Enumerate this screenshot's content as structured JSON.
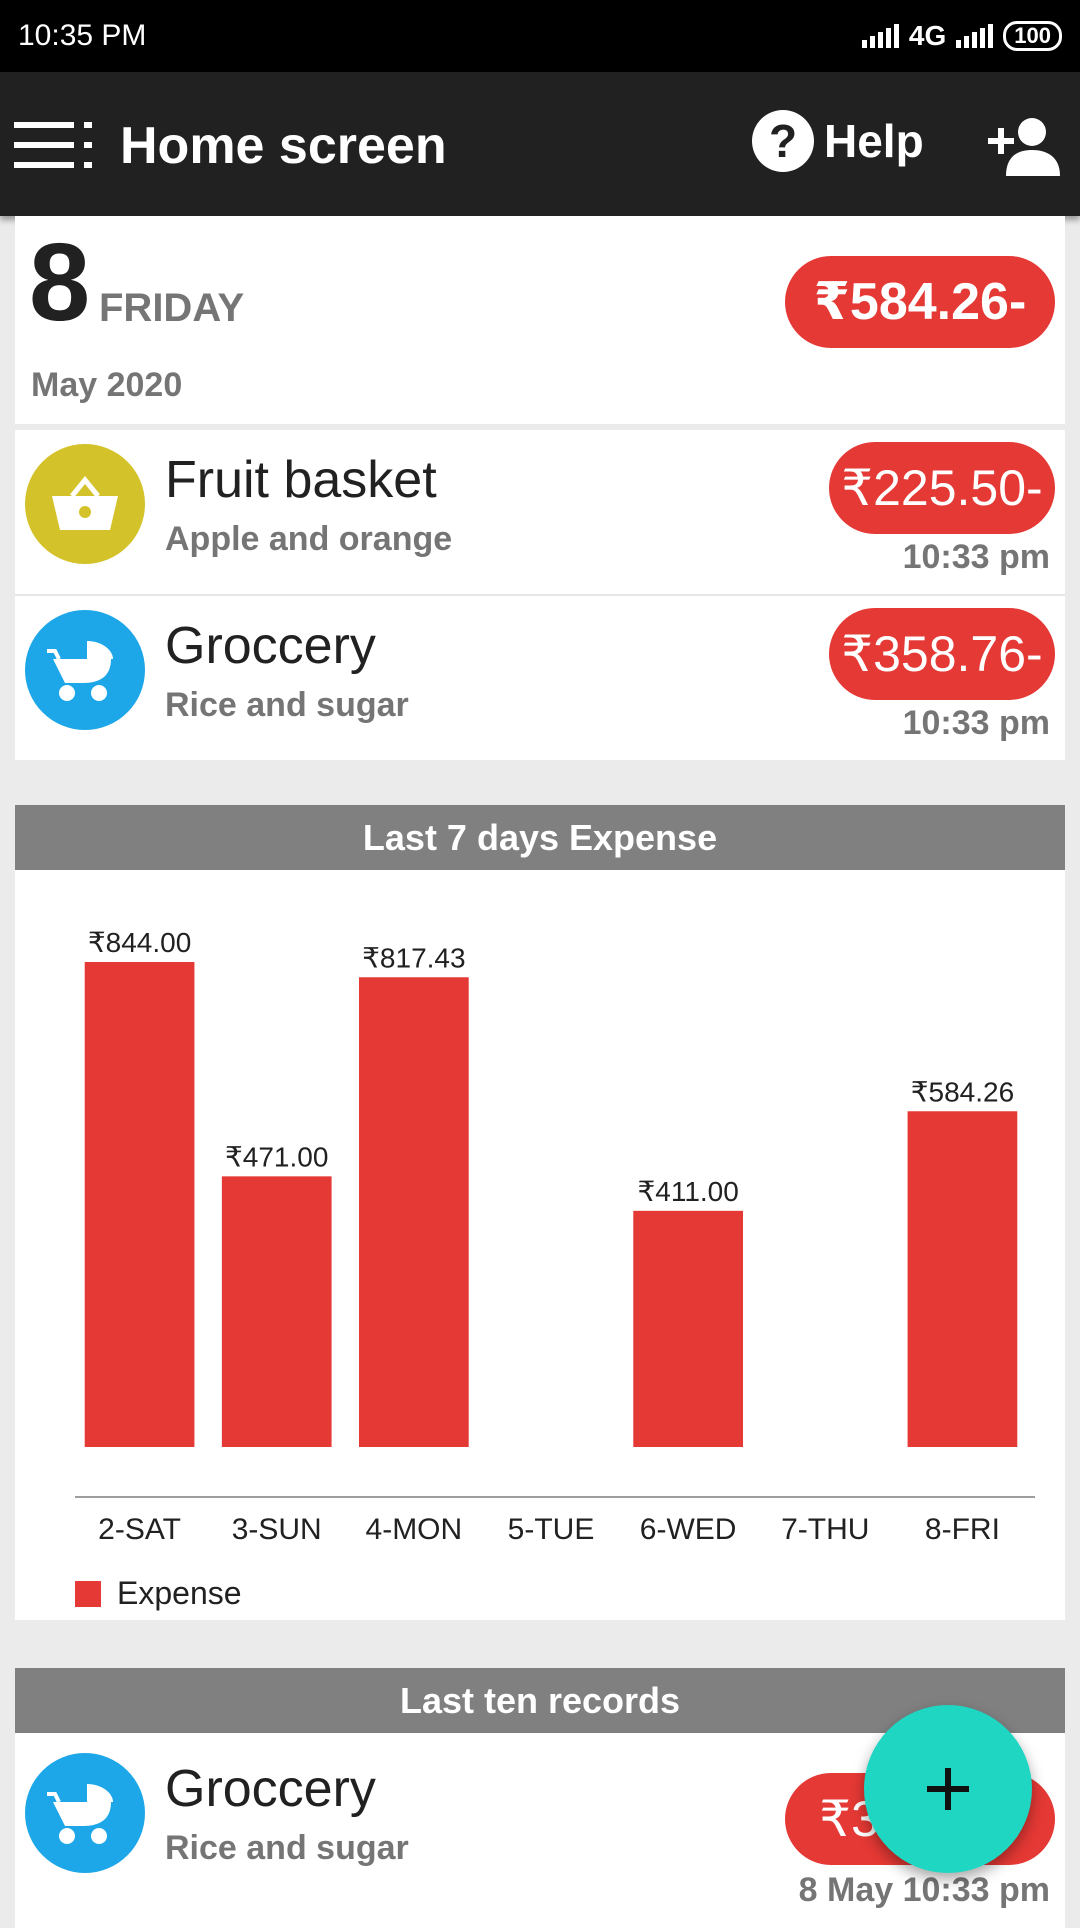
{
  "status_bar": {
    "time": "10:35 PM",
    "network": "4G",
    "battery": "100"
  },
  "app_bar": {
    "title": "Home screen",
    "help_label": "Help"
  },
  "day_summary": {
    "day_number": "8",
    "day_name": "FRIDAY",
    "month_year": "May 2020",
    "total": "₹584.26-"
  },
  "transactions": [
    {
      "title": "Fruit basket",
      "subtitle": "Apple and orange",
      "amount": "₹225.50-",
      "time": "10:33 pm",
      "icon": "basket-icon",
      "icon_color": "#d4c22a"
    },
    {
      "title": "Groccery",
      "subtitle": "Rice and sugar",
      "amount": "₹358.76-",
      "time": "10:33 pm",
      "icon": "stroller-cart-icon",
      "icon_color": "#1ea7e8"
    }
  ],
  "chart_section": {
    "header": "Last 7 days Expense",
    "legend_label": "Expense"
  },
  "chart_data": {
    "type": "bar",
    "categories": [
      "2-SAT",
      "3-SUN",
      "4-MON",
      "5-TUE",
      "6-WED",
      "7-THU",
      "8-FRI"
    ],
    "series": [
      {
        "name": "Expense",
        "values": [
          844.0,
          471.0,
          817.43,
          0,
          411.0,
          0,
          584.26
        ],
        "color": "#e53935"
      }
    ],
    "data_labels": [
      "₹844.00",
      "₹471.00",
      "₹817.43",
      "",
      "₹411.00",
      "",
      "₹584.26"
    ],
    "ylim": [
      0,
      844
    ],
    "legend": "bottom-left",
    "grid": false
  },
  "records_section": {
    "header": "Last ten records",
    "records": [
      {
        "title": "Groccery",
        "subtitle": "Rice and sugar",
        "amount": "₹358.76-",
        "time": "8 May 10:33 pm",
        "icon": "stroller-cart-icon",
        "icon_color": "#1ea7e8"
      }
    ]
  },
  "colors": {
    "accent_red": "#e53935",
    "app_bar": "#212121",
    "fab": "#1fd6c3",
    "section_header": "#808080"
  }
}
